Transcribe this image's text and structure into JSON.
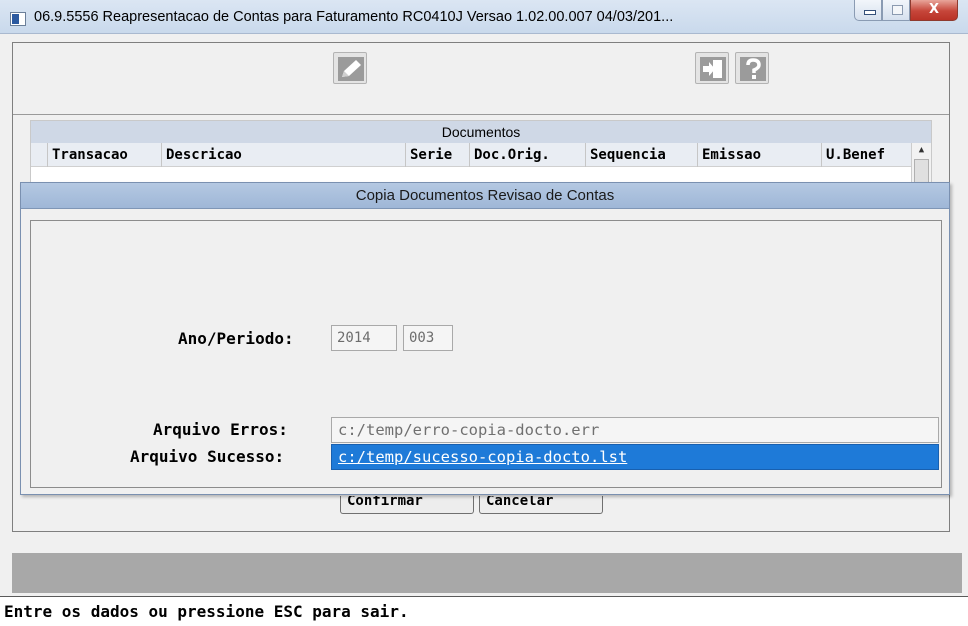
{
  "window": {
    "title": "06.9.5556  Reapresentacao de Contas para Faturamento RC0410J Versao 1.02.00.007 04/03/201...",
    "close_glyph": "X"
  },
  "toolbar": {
    "icons": [
      "edit-icon",
      "exit-icon",
      "help-icon"
    ]
  },
  "grid": {
    "caption": "Documentos",
    "columns": [
      "Transacao",
      "Descricao",
      "Serie",
      "Doc.Orig.",
      "Sequencia",
      "Emissao",
      "U.Benef"
    ],
    "scroll_up": "▲"
  },
  "buttons": {
    "confirm": "Confirmar",
    "cancel": "Cancelar"
  },
  "dialog": {
    "title": "Copia Documentos Revisao de Contas",
    "ano_periodo_label": "Ano/Periodo:",
    "ano": "2014",
    "periodo": "003",
    "arquivo_erros_label": "Arquivo Erros:",
    "arquivo_erros": "c:/temp/erro-copia-docto.err",
    "arquivo_sucesso_label": "Arquivo Sucesso:",
    "arquivo_sucesso": "c:/temp/sucesso-copia-docto.lst"
  },
  "status": {
    "message": "Entre os dados ou pressione ESC para sair."
  },
  "colors": {
    "selection": "#1e7ad8",
    "caption_bar": "#cfd8e6",
    "dialog_title": "#a9bfdc"
  }
}
